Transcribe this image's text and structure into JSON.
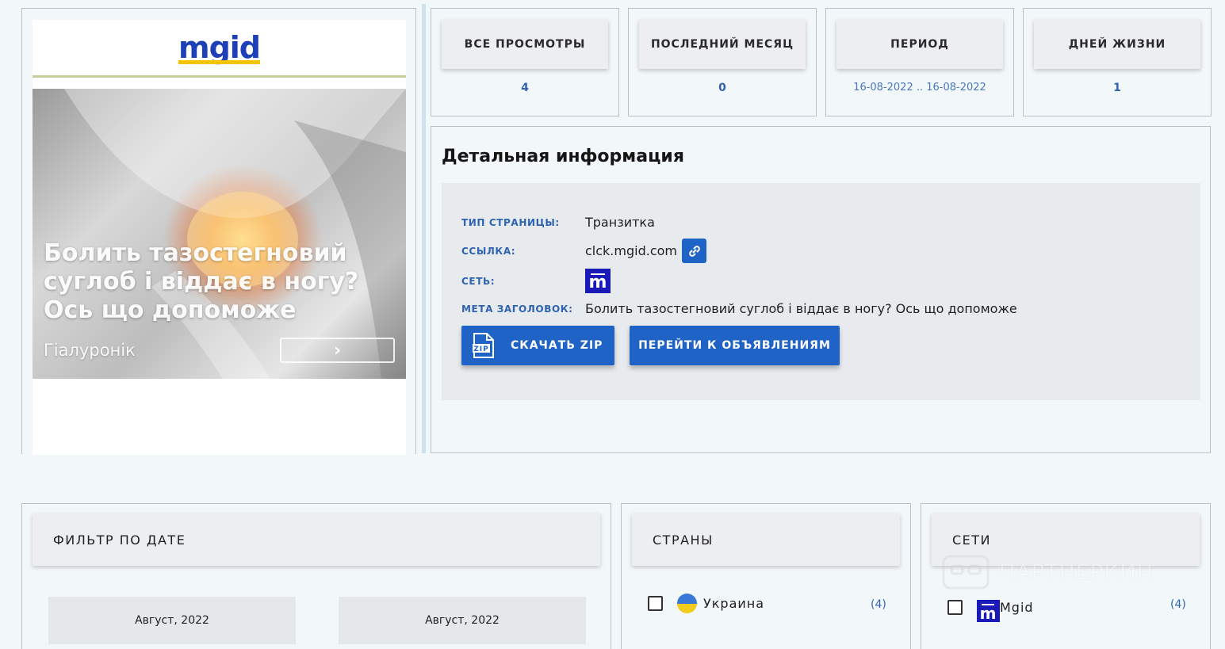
{
  "preview": {
    "logo_text": "mgid",
    "ad_headline": "Болить тазостегновий суглоб і віддає в ногу? Ось що допоможе",
    "ad_brand": "Гіалуронік"
  },
  "stats": [
    {
      "label": "ВСЕ ПРОСМОТРЫ",
      "value": "4"
    },
    {
      "label": "ПОСЛЕДНИЙ МЕСЯЦ",
      "value": "0"
    },
    {
      "label": "ПЕРИОД",
      "value": "16-08-2022 .. 16-08-2022"
    },
    {
      "label": "ДНЕЙ ЖИЗНИ",
      "value": "1"
    }
  ],
  "details": {
    "title": "Детальная информация",
    "rows": {
      "page_type": {
        "label": "ТИП СТРАНИЦЫ:",
        "value": "Транзитка"
      },
      "link": {
        "label": "ССЫЛКА:",
        "value": "clck.mgid.com"
      },
      "network": {
        "label": "СЕТЬ:",
        "value": ""
      },
      "meta_title": {
        "label": "МЕТА ЗАГОЛОВОК:",
        "value": "Болить тазостегновий суглоб і віддає в ногу? Ось що допоможе"
      }
    },
    "zip_button": "СКАЧАТЬ ZIP",
    "zip_icon_text": "ZIP",
    "ads_button": "ПЕРЕЙТИ К ОБЪЯВЛЕНИЯМ"
  },
  "filters": {
    "date": {
      "title": "ФИЛЬТР ПО ДАТЕ",
      "from": "Август, 2022",
      "to": "Август, 2022"
    },
    "countries": {
      "title": "СТРАНЫ",
      "items": [
        {
          "name": "Украина",
          "count": "(4)"
        }
      ]
    },
    "networks": {
      "title": "СЕТИ",
      "items": [
        {
          "name": "Mgid",
          "count": "(4)"
        }
      ]
    }
  },
  "watermark": "ПАРТНЕРКИН",
  "colors": {
    "accent": "#1f63c6",
    "label": "#2f63b2",
    "background": "#f2f7fa",
    "network_brand": "#1a1ab8"
  }
}
